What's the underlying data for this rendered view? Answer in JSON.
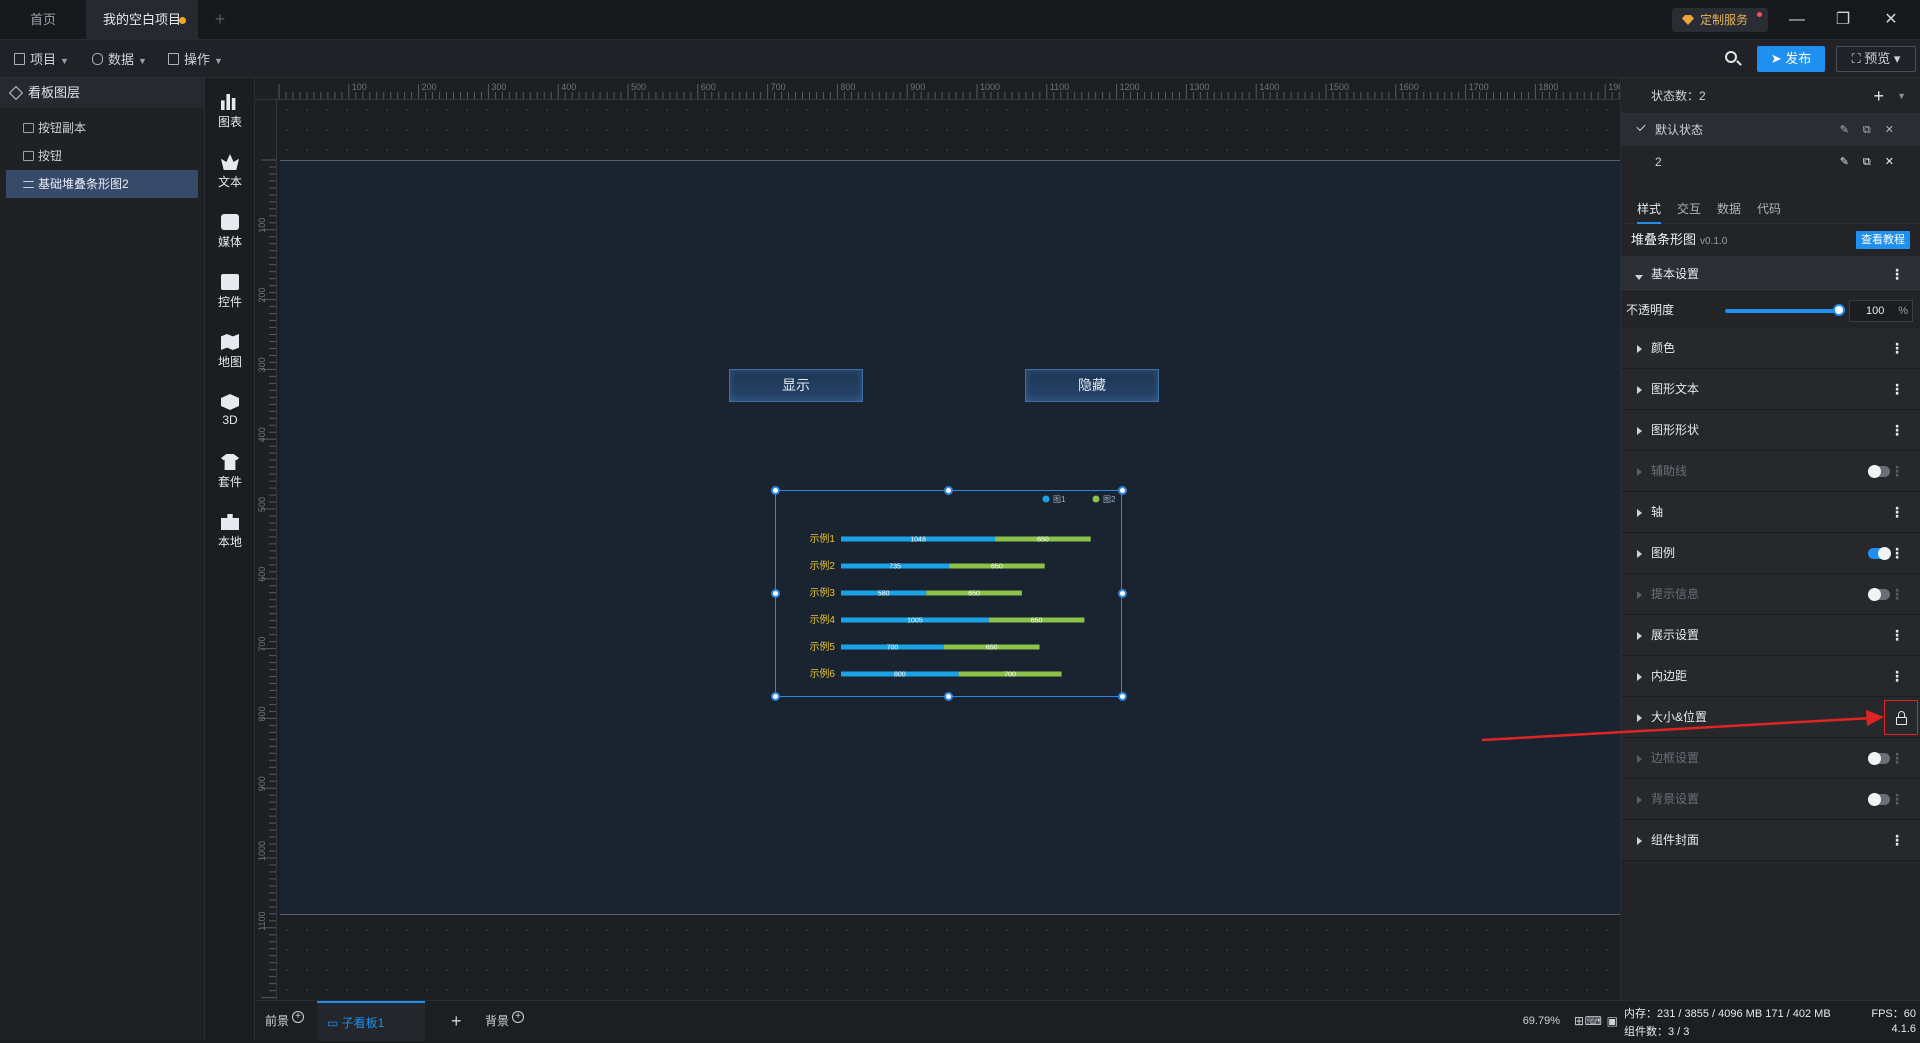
{
  "titlebar": {
    "tabs": [
      {
        "label": "首页"
      },
      {
        "label": "我的空白项目"
      }
    ],
    "custom_service": "定制服务"
  },
  "toolbar": {
    "menus": [
      {
        "label": "项目"
      },
      {
        "label": "数据"
      },
      {
        "label": "操作"
      }
    ],
    "publish": "发布",
    "preview": "预览"
  },
  "layers": {
    "title": "看板图层",
    "items": [
      {
        "label": "按钮副本"
      },
      {
        "label": "按钮"
      },
      {
        "label": "基础堆叠条形图2"
      }
    ]
  },
  "toolbox": [
    {
      "label": "图表",
      "icon": "bar-chart-icon"
    },
    {
      "label": "文本",
      "icon": "text-icon"
    },
    {
      "label": "媒体",
      "icon": "media-icon"
    },
    {
      "label": "控件",
      "icon": "control-icon"
    },
    {
      "label": "地图",
      "icon": "map-icon"
    },
    {
      "label": "3D",
      "icon": "cube-icon"
    },
    {
      "label": "套件",
      "icon": "shirt-icon"
    },
    {
      "label": "本地",
      "icon": "puzzle-icon"
    }
  ],
  "ruler": {
    "top_ticks": [
      "100",
      "200",
      "300",
      "400",
      "500",
      "600",
      "700",
      "800",
      "900",
      "1000",
      "1100",
      "1200",
      "1300",
      "1400",
      "1500",
      "1600",
      "1700",
      "1800",
      "1900"
    ],
    "left_ticks": [
      "100",
      "200",
      "300",
      "400",
      "500",
      "600",
      "700",
      "800",
      "900",
      "1000",
      "1100"
    ]
  },
  "canvas": {
    "show_button": "显示",
    "hide_button": "隐藏"
  },
  "chart_data": {
    "type": "bar",
    "orientation": "horizontal",
    "stacked": true,
    "categories": [
      "示例1",
      "示例2",
      "示例3",
      "示例4",
      "示例5",
      "示例6"
    ],
    "series": [
      {
        "name": "图1",
        "color": "#1aa3e6",
        "values": [
          1048,
          735,
          580,
          1005,
          700,
          800
        ]
      },
      {
        "name": "图2",
        "color": "#8bc34a",
        "values": [
          650,
          650,
          650,
          650,
          650,
          700
        ]
      }
    ],
    "legend": "top-right",
    "label_color": "#e6c232"
  },
  "props": {
    "state_count_label": "状态数：2",
    "states": [
      {
        "label": "默认状态"
      },
      {
        "label": "2"
      }
    ],
    "tabs": [
      "样式",
      "交互",
      "数据",
      "代码"
    ],
    "component_name": "堆叠条形图",
    "version": "v0.1.0",
    "tutorial": "查看教程",
    "basic_settings": "基本设置",
    "opacity_label": "不透明度",
    "opacity_value": "100",
    "opacity_unit": "%",
    "sections": [
      {
        "label": "颜色",
        "dim": false,
        "toggle": null
      },
      {
        "label": "图形文本",
        "dim": false,
        "toggle": null
      },
      {
        "label": "图形形状",
        "dim": false,
        "toggle": null
      },
      {
        "label": "辅助线",
        "dim": true,
        "toggle": "off"
      },
      {
        "label": "轴",
        "dim": false,
        "toggle": null
      },
      {
        "label": "图例",
        "dim": false,
        "toggle": "on"
      },
      {
        "label": "提示信息",
        "dim": true,
        "toggle": "off"
      },
      {
        "label": "展示设置",
        "dim": false,
        "toggle": null
      },
      {
        "label": "内边距",
        "dim": false,
        "toggle": null
      },
      {
        "label": "大小&位置",
        "dim": false,
        "toggle": "lock"
      },
      {
        "label": "边框设置",
        "dim": true,
        "toggle": "off"
      },
      {
        "label": "背景设置",
        "dim": true,
        "toggle": "off"
      },
      {
        "label": "组件封面",
        "dim": false,
        "toggle": null
      }
    ]
  },
  "bottom": {
    "foreground": "前景",
    "sub_board": "子看板1",
    "background": "背景",
    "zoom": "69.79%"
  },
  "status": {
    "memory": "内存：231 / 3855 / 4096 MB  171 / 402 MB",
    "components": "组件数：3 / 3",
    "fps": "FPS：60",
    "version": "4.1.6"
  }
}
